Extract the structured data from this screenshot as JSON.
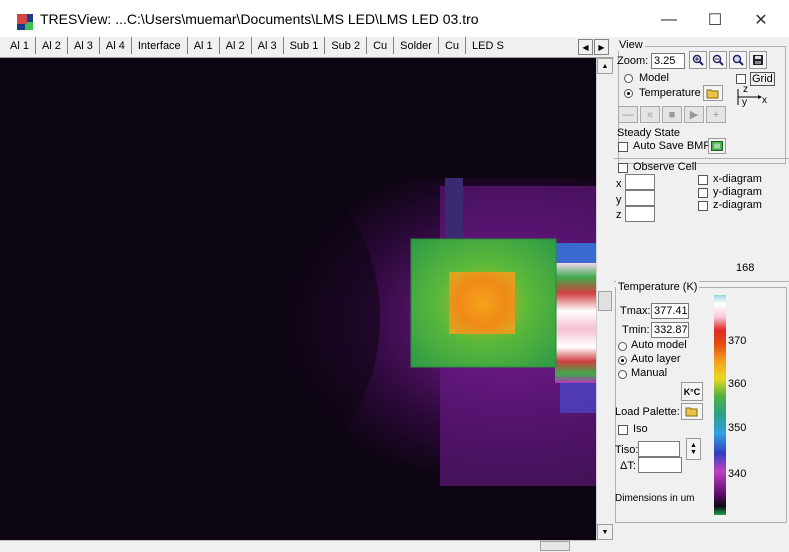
{
  "window": {
    "title": "TRESView: ...C:\\Users\\muemar\\Documents\\LMS LED\\LMS LED 03.tro",
    "minimize": "—",
    "maximize": "☐",
    "close": "✕"
  },
  "tabs": [
    "Al 1",
    "Al 2",
    "Al 3",
    "Al 4",
    "Interface",
    "Al 1",
    "Al 2",
    "Al 3",
    "Sub 1",
    "Sub 2",
    "Cu",
    "Solder",
    "Cu",
    "LED S"
  ],
  "tab_arrows": {
    "left": "◀",
    "right": "▶"
  },
  "view": {
    "group_label": "View",
    "zoom_label": "Zoom:",
    "zoom_value": "3.25",
    "model_label": "Model",
    "temperature_label": "Temperature",
    "grid_label": "Grid",
    "steady_state_label": "Steady State",
    "auto_save_label": "Auto Save BMP",
    "axis_z": "z",
    "axis_x": "x",
    "axis_y": "y"
  },
  "playback": {
    "minus": "—",
    "rewind": "«",
    "stop": "■",
    "play": "▶",
    "plus": "+"
  },
  "observe": {
    "observe_label": "Observe Cell",
    "x_label": "x",
    "y_label": "y",
    "z_label": "z",
    "x_diagram": "x-diagram",
    "y_diagram": "y-diagram",
    "z_diagram": "z-diagram",
    "count": "168"
  },
  "temperature": {
    "group_label": "Temperature (K)",
    "tmax_label": "Tmax:",
    "tmax_value": "377.41",
    "tmin_label": "Tmin:",
    "tmin_value": "332.87",
    "auto_model": "Auto model",
    "auto_layer": "Auto layer",
    "manual": "Manual",
    "k_c_label": "K°C",
    "load_palette": "Load Palette:",
    "iso_label": "Iso",
    "tiso_label": "Tiso:",
    "delta_t_label": "ΔT:",
    "dimensions_label": "Dimensions in um",
    "scale_ticks": [
      "370",
      "360",
      "350",
      "340"
    ]
  },
  "colors": {
    "hot": "#f7a21b",
    "mid": "#3daa4a",
    "cool": "#b03ab8",
    "cold": "#0d0512"
  }
}
